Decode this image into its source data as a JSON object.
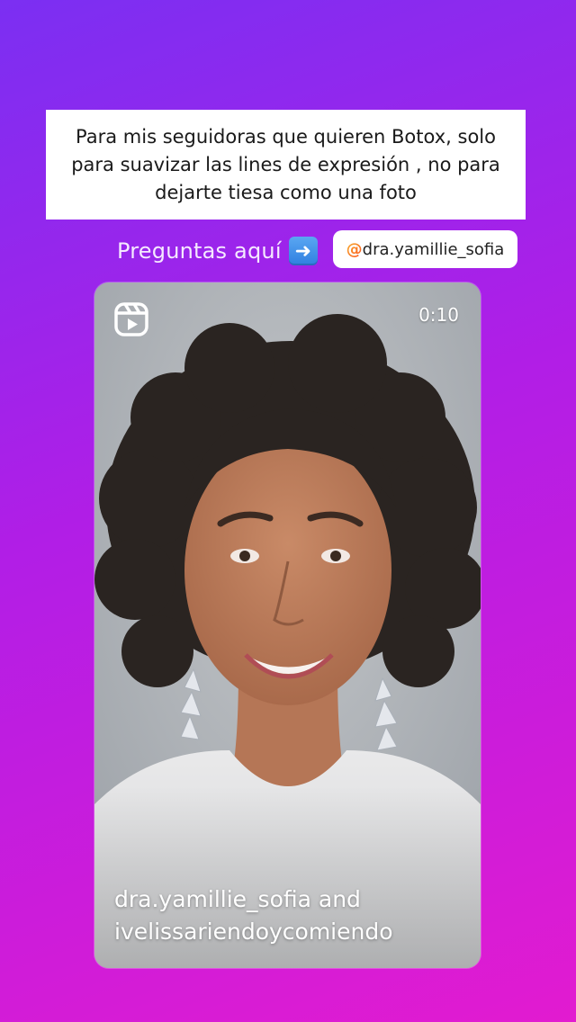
{
  "story": {
    "caption": "Para mis seguidoras que quieren Botox, solo para suavizar las lines de expresión , no para dejarte tiesa como una foto",
    "prompt": "Preguntas aquí",
    "prompt_emoji": "arrow-right-emoji",
    "mention": {
      "at_symbol": "@",
      "username": "dra.yamillie_sofia"
    }
  },
  "reel": {
    "icon": "reels-icon",
    "duration": "0:10",
    "credit_line_1": "dra.yamillie_sofia and",
    "credit_line_2": "ivelissariendoycomiendo"
  },
  "colors": {
    "gradient_start": "#7b2ff2",
    "gradient_end": "#e21bd0",
    "caption_bg": "#ffffff",
    "mention_at": "#f7971e"
  }
}
